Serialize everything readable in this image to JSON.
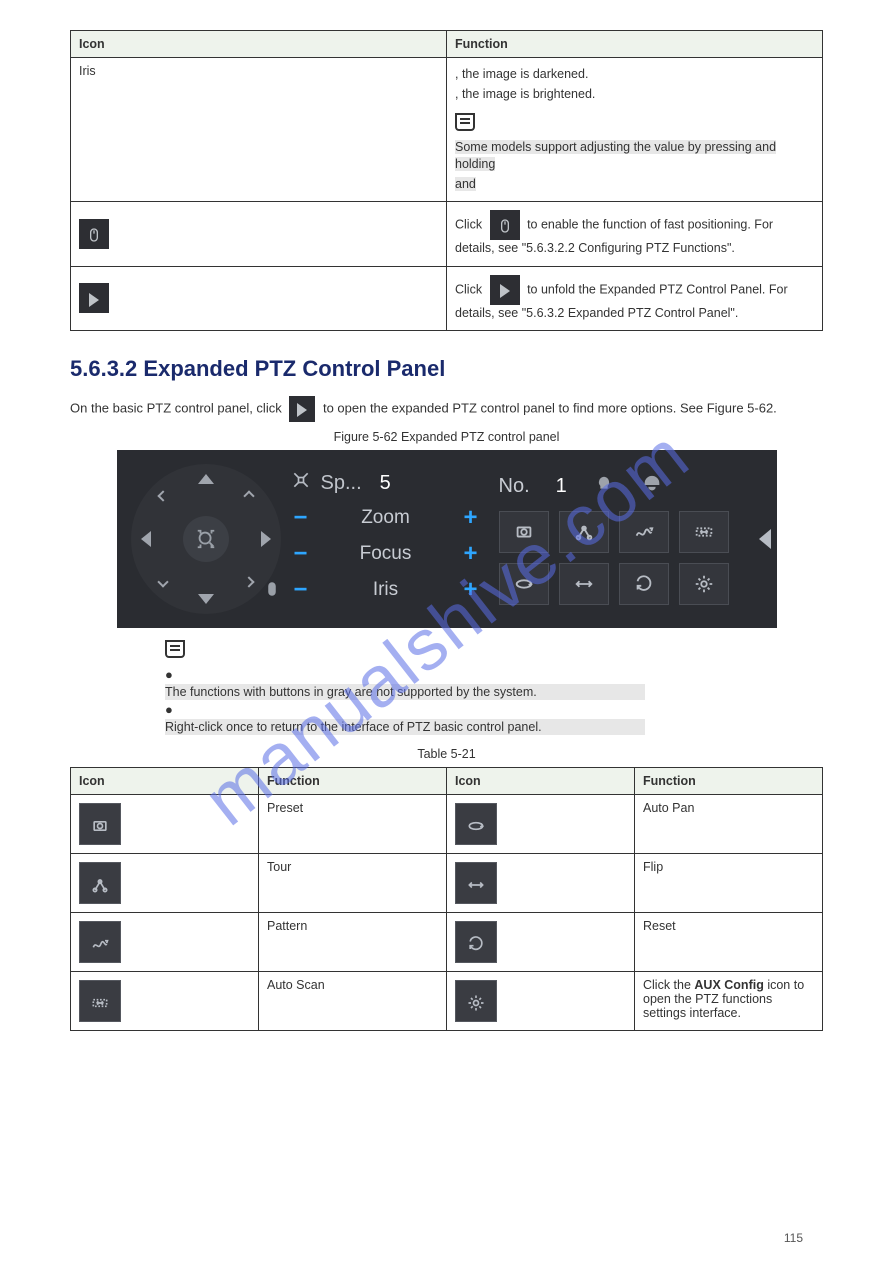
{
  "page_number": "115",
  "watermark": "manualshive.com",
  "table1": {
    "headers": {
      "icon": "Icon",
      "function": "Function"
    },
    "row_iris": {
      "label": "Iris",
      "desc_line1": ", the image is darkened.",
      "desc_line2": ", the image is brightened.",
      "note_intro": "",
      "note_shade1": "Some models support adjusting the value by pressing and holding",
      "note_shade2": " and"
    },
    "row_mouse": {
      "icon_name": "mouse-icon",
      "desc_pre": "Click",
      "desc_post": " to enable the function of fast positioning. For details, see \"5.6.3.2.2 Configuring PTZ Functions\"."
    },
    "row_play": {
      "icon_name": "expand-icon",
      "desc_pre": "Click",
      "desc_post": " to unfold the Expanded PTZ Control Panel. For details, see \"5.6.3.2 Expanded PTZ Control Panel\"."
    }
  },
  "section": {
    "number": "5.6.3.2",
    "title": "Expanded PTZ Control Panel",
    "para": "On the basic PTZ control panel, click",
    "para_end": " to open the expanded PTZ control panel to find more options. See Figure 5-62."
  },
  "figure": {
    "label": "Figure 5-62 Expanded PTZ control panel"
  },
  "ptz": {
    "speed_label": "Sp...",
    "speed_value": "5",
    "zoom": "Zoom",
    "focus": "Focus",
    "iris": "Iris",
    "no_label": "No.",
    "no_value": "1"
  },
  "note_below": {
    "line1": "The functions with buttons in gray are not supported by the system.",
    "line2": "Right-click once to return to the interface of PTZ basic control panel."
  },
  "table2": {
    "caption": "Table 5-21",
    "headers": {
      "icon": "Icon",
      "function": "Function"
    },
    "rows": [
      {
        "fn1": "Preset",
        "fn2": "Auto Pan"
      },
      {
        "fn1": "Tour",
        "fn2": "Flip"
      },
      {
        "fn1": "Pattern",
        "fn2": "Reset"
      },
      {
        "fn1": "Auto Scan",
        "fn2_pre": "Click the ",
        "fn2_mid": "AUX Config",
        "fn2_post": " icon to open the PTZ functions settings interface."
      }
    ]
  }
}
